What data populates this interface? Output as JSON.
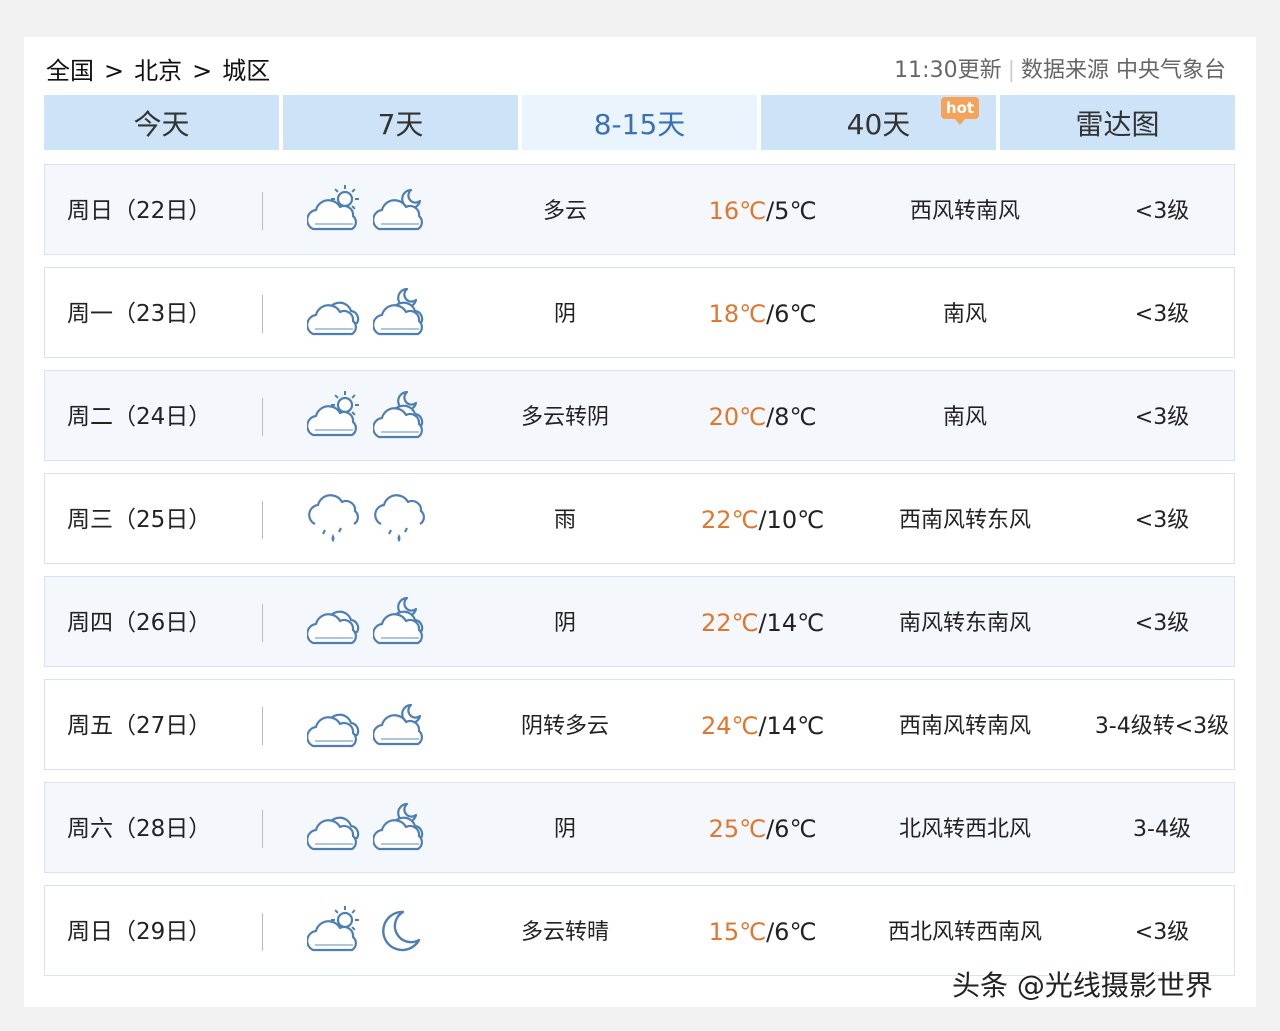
{
  "breadcrumb": {
    "country": "全国",
    "sep1": ">",
    "city": "北京",
    "sep2": ">",
    "district": "城区"
  },
  "meta": {
    "update": "11:30更新",
    "divider": "|",
    "source": "数据来源 中央气象台"
  },
  "tabs": [
    {
      "label": "今天"
    },
    {
      "label": "7天"
    },
    {
      "label": "8-15天",
      "active": true
    },
    {
      "label": "40天",
      "badge": "hot"
    },
    {
      "label": "雷达图"
    }
  ],
  "days": [
    {
      "day": "周日（22日）",
      "desc": "多云",
      "hi": "16℃",
      "slash": "/",
      "lo": "5℃",
      "wind": "西风转南风",
      "level": "<3级",
      "icon_day": "partly-cloudy-sun",
      "icon_night": "partly-cloudy-moon"
    },
    {
      "day": "周一（23日）",
      "desc": "阴",
      "hi": "18℃",
      "slash": "/",
      "lo": "6℃",
      "wind": "南风",
      "level": "<3级",
      "icon_day": "overcast",
      "icon_night": "overcast-moon"
    },
    {
      "day": "周二（24日）",
      "desc": "多云转阴",
      "hi": "20℃",
      "slash": "/",
      "lo": "8℃",
      "wind": "南风",
      "level": "<3级",
      "icon_day": "partly-cloudy-sun",
      "icon_night": "overcast-moon"
    },
    {
      "day": "周三（25日）",
      "desc": "雨",
      "hi": "22℃",
      "slash": "/",
      "lo": "10℃",
      "wind": "西南风转东风",
      "level": "<3级",
      "icon_day": "rain",
      "icon_night": "rain"
    },
    {
      "day": "周四（26日）",
      "desc": "阴",
      "hi": "22℃",
      "slash": "/",
      "lo": "14℃",
      "wind": "南风转东南风",
      "level": "<3级",
      "icon_day": "overcast",
      "icon_night": "overcast-moon"
    },
    {
      "day": "周五（27日）",
      "desc": "阴转多云",
      "hi": "24℃",
      "slash": "/",
      "lo": "14℃",
      "wind": "西南风转南风",
      "level": "3-4级转<3级",
      "icon_day": "overcast",
      "icon_night": "partly-cloudy-moon"
    },
    {
      "day": "周六（28日）",
      "desc": "阴",
      "hi": "25℃",
      "slash": "/",
      "lo": "6℃",
      "wind": "北风转西北风",
      "level": "3-4级",
      "icon_day": "overcast",
      "icon_night": "overcast-moon"
    },
    {
      "day": "周日（29日）",
      "desc": "多云转晴",
      "hi": "15℃",
      "slash": "/",
      "lo": "6℃",
      "wind": "西北风转西南风",
      "level": "<3级",
      "icon_day": "partly-cloudy-sun",
      "icon_night": "clear-moon"
    }
  ],
  "watermark": "头条 @光线摄影世界",
  "colors": {
    "tab_bg": "#cde3f7",
    "tab_active_bg": "#eaf4fd",
    "tab_active_text": "#3b6fb6",
    "high_temp": "#e0772f",
    "icon_stroke": "#4d7fb5",
    "hot_badge": "#f5a35a"
  }
}
